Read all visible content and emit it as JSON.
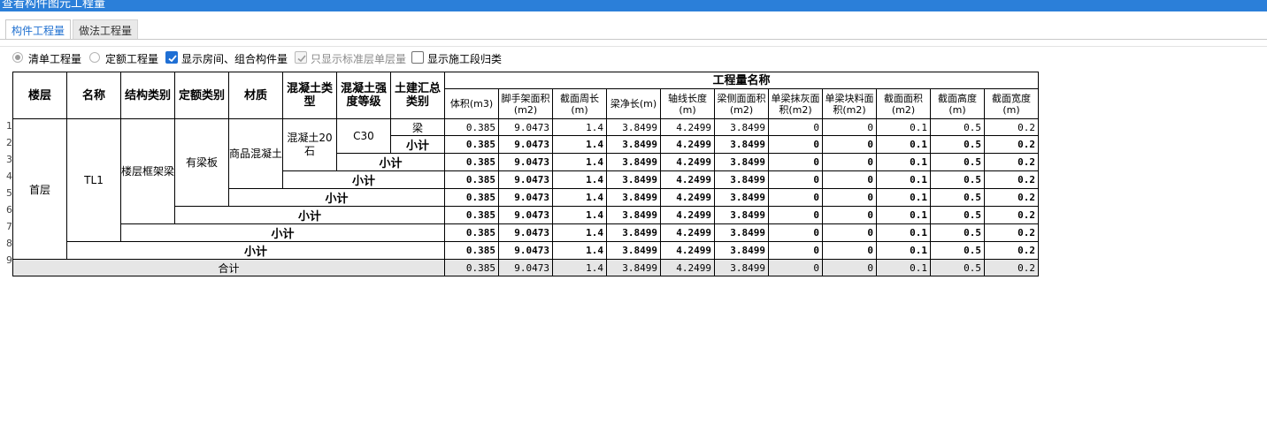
{
  "window": {
    "title": "查看构件图元工程量"
  },
  "tabs": [
    {
      "label": "构件工程量",
      "active": true
    },
    {
      "label": "做法工程量",
      "active": false
    }
  ],
  "options": [
    {
      "label": "清单工程量",
      "type": "radio",
      "checked": true
    },
    {
      "label": "定额工程量",
      "type": "radio",
      "checked": false
    },
    {
      "label": "显示房间、组合构件量",
      "type": "checkbox",
      "checked": true,
      "disabled": false
    },
    {
      "label": "只显示标准层单层量",
      "type": "checkbox",
      "checked": true,
      "disabled": true
    },
    {
      "label": "显示施工段归类",
      "type": "checkbox",
      "checked": false,
      "disabled": false
    }
  ],
  "table": {
    "group_header": "工程量名称",
    "dim_headers": [
      "楼层",
      "名称",
      "结构类别",
      "定额类别",
      "材质",
      "混凝土类型",
      "混凝土强度等级",
      "土建汇总类别"
    ],
    "measure_headers": [
      "体积(m3)",
      "脚手架面积(m2)",
      "截面周长(m)",
      "梁净长(m)",
      "轴线长度(m)",
      "梁侧面面积(m2)",
      "单梁抹灰面积(m2)",
      "单梁块料面积(m2)",
      "截面面积(m2)",
      "截面高度(m)",
      "截面宽度(m)"
    ],
    "row_numbers": [
      "1",
      "2",
      "3",
      "4",
      "5",
      "6",
      "7",
      "8",
      "9"
    ],
    "cells": {
      "floor": "首层",
      "name": "TL1",
      "struct_type": "楼层框架梁",
      "quota_type": "有梁板",
      "material": "商品混凝土",
      "concrete_type": "混凝土20石",
      "grade": "C30",
      "category": "梁"
    },
    "subtotal_label": "小计",
    "total_label": "合计",
    "values": [
      "0.385",
      "9.0473",
      "1.4",
      "3.8499",
      "4.2499",
      "3.8499",
      "0",
      "0",
      "0.1",
      "0.5",
      "0.2"
    ]
  }
}
